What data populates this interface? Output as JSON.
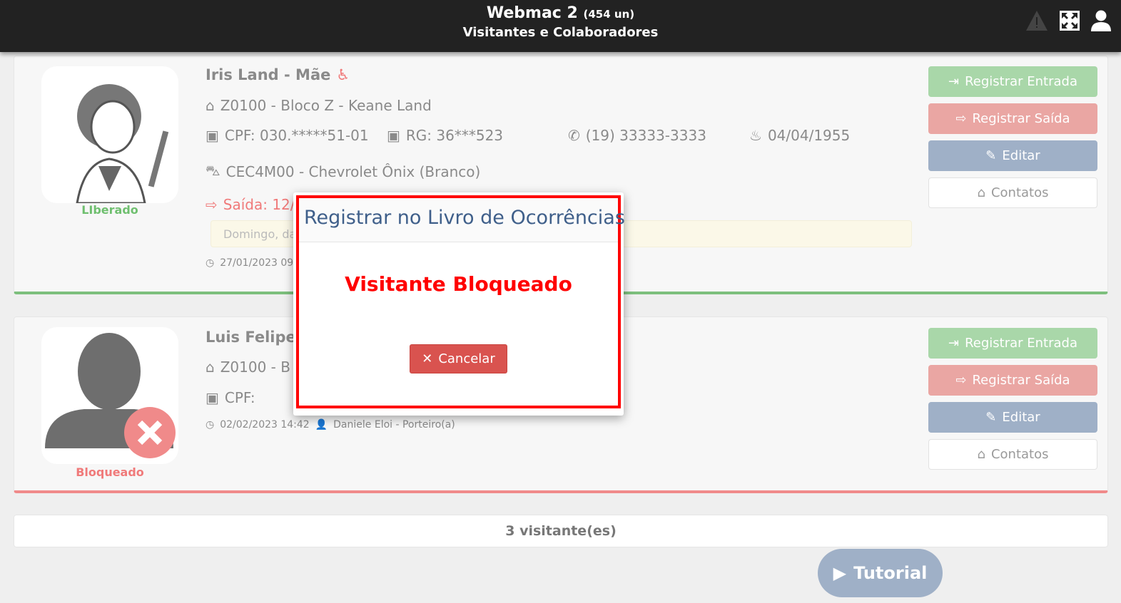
{
  "header": {
    "title": "Webmac 2",
    "count": "(454 un)",
    "subtitle": "Visitantes e Colaboradores",
    "icons": [
      "warning-icon",
      "expand-icon",
      "user-icon"
    ]
  },
  "visitors": [
    {
      "name": "Iris Land - Mãe",
      "unit": "Z0100 - Bloco Z - Keane Land",
      "cpf": "CPF: 030.*****51-01",
      "rg": "RG: 36***523",
      "phone": "(19) 33333-3333",
      "birth": "04/04/1955",
      "vehicle": "CEC4M00 - Chevrolet Ônix (Branco)",
      "exit": "Saída: 12/",
      "note": "Domingo, da",
      "timestamp": "27/01/2023 09",
      "status": "LIberado",
      "status_color": "#6fbf6f"
    },
    {
      "name": "Luis Felipe -",
      "unit": "Z0100 - B",
      "cpf": "CPF:",
      "timestamp": "02/02/2023 14:42",
      "author": "Daniele Eloi - Porteiro(a)",
      "status": "Bloqueado",
      "status_color": "#f07a7a"
    }
  ],
  "actions": {
    "entry": "Registrar Entrada",
    "exit": "Registrar Saída",
    "edit": "Editar",
    "contacts": "Contatos"
  },
  "footer": {
    "count": "3 visitante(es)",
    "tutorial": "Tutorial"
  },
  "modal": {
    "title": "Registrar no Livro de Ocorrências",
    "message": "Visitante Bloqueado",
    "cancel": "Cancelar"
  }
}
